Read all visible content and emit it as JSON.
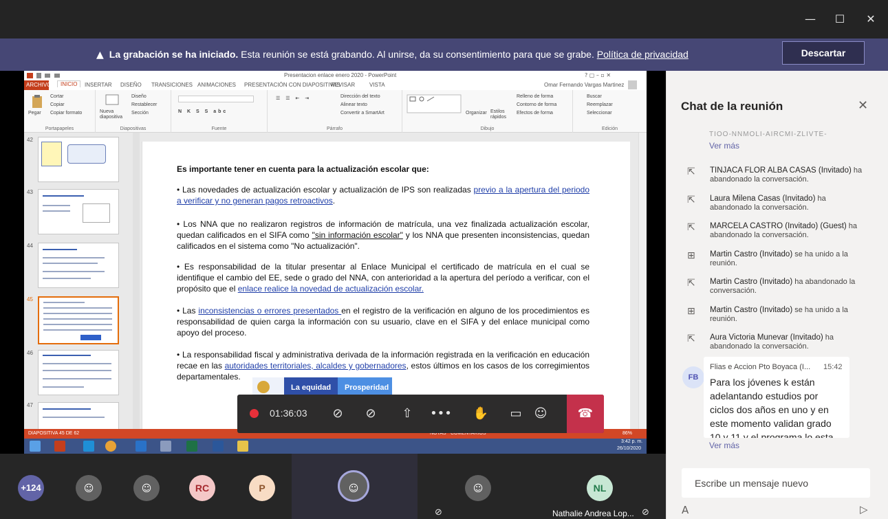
{
  "window": {
    "minimize_icon": "—",
    "maximize_icon": "☐",
    "close_icon": "✕"
  },
  "banner": {
    "bold": "La grabación se ha iniciado.",
    "text": " Esta reunión se está grabando. Al unirse, da su consentimiento para que se grabe. ",
    "link": "Política de privacidad",
    "dismiss": "Descartar"
  },
  "ppt": {
    "window_title": "Presentacion enlace enero 2020 - PowerPoint",
    "user": "Omar Fernando Vargas Martinez",
    "tabs": [
      "ARCHIVO",
      "INICIO",
      "INSERTAR",
      "DISEÑO",
      "TRANSICIONES",
      "ANIMACIONES",
      "PRESENTACIÓN CON DIAPOSITIVAS",
      "REVISAR",
      "VISTA"
    ],
    "ribbon": {
      "paste": "Pegar",
      "cut": "Cortar",
      "copy": "Copiar",
      "copy_format": "Copiar formato",
      "new_slide": "Nueva diapositiva",
      "layout": "Diseño",
      "reset": "Restablecer",
      "section": "Sección",
      "text_direction": "Dirección del texto",
      "align_text": "Alinear texto",
      "convert_smartart": "Convertir a SmartArt",
      "arrange": "Organizar",
      "styles": "Estilos rápidos",
      "shape_fill": "Relleno de forma",
      "shape_outline": "Contorno de forma",
      "shape_effects": "Efectos de forma",
      "find": "Buscar",
      "replace": "Reemplazar",
      "select": "Seleccionar",
      "groups": [
        "Portapapeles",
        "Diapositivas",
        "Fuente",
        "Párrafo",
        "Dibujo",
        "Edición"
      ]
    },
    "thumb_numbers": [
      "42",
      "43",
      "44",
      "45",
      "46",
      "47"
    ],
    "status_slide": "DIAPOSITIVA 45 DE 62",
    "status_notes": "NOTAS",
    "status_comments": "COMENTARIOS",
    "status_zoom": "86%",
    "taskbar_time": "3:42 p. m.",
    "taskbar_date": "26/10/2020"
  },
  "slide": {
    "heading": "Es importante tener en cuenta para la actualización escolar que:",
    "p1_a": "• Las novedades de actualización escolar y actualización de IPS son  realizadas ",
    "p1_link": "previo a la apertura del periodo a verificar y no generan pagos retroactivos",
    "p1_b": ".",
    "p2_a": "• Los NNA que no realizaron registros de información de matrícula, una vez finalizada actualización escolar, quedan calificados en el SIFA como ",
    "p2_link": "\"sin información escolar\"",
    "p2_b": " y los NNA que presenten inconsistencias, quedan calificados en el sistema como \"No actualización\".",
    "p3_a": "• Es responsabilidad de la titular presentar al Enlace Municipal el certificado de matrícula en el cual se identifique el cambio del EE, sede o grado del NNA, con anterioridad a la apertura del período a verificar, con el propósito que el ",
    "p3_link": "enlace realice la novedad de actualización escolar.",
    "p4_a": "• Las ",
    "p4_link": "inconsistencias o errores presentados ",
    "p4_b": "en el registro de la verificación en alguno de los procedimientos es responsabilidad de quien carga la información con su usuario, clave en el SIFA y del enlace municipal como apoyo del proceso.",
    "p5_a": "• La responsabilidad fiscal y administrativa derivada de la información registrada en la verificación en educación recae en las ",
    "p5_link": "autoridades territoriales, alcaldes y gobernadores",
    "p5_b": ", estos últimos en los casos de los corregimientos departamentales.",
    "logo_left": "La equidad",
    "logo_right": "Prosperidad"
  },
  "callbar": {
    "timer": "01:36:03"
  },
  "participants": {
    "overflow": "+124",
    "rc": "RC",
    "p": "P",
    "nl": "NL",
    "nl_name": "Nathalie Andrea Lop..."
  },
  "chat": {
    "title": "Chat de la reunión",
    "clipped": "TIOO-NNMOLI-AIRCMI-ZLIVTE-",
    "see_more": "Ver más",
    "events": [
      {
        "name": "TINJACA FLOR ALBA CASAS (Invitado)",
        "tail": " ha",
        "rest": "abandonado la conversación.",
        "icon": "⇱"
      },
      {
        "name": "Laura Milena Casas (Invitado)",
        "tail": " ha",
        "rest": "abandonado la conversación.",
        "icon": "⇱"
      },
      {
        "name": "MARCELA CASTRO (Invitado) (Guest)",
        "tail": " ha",
        "rest": "abandonado la conversación.",
        "icon": "⇱"
      },
      {
        "name": "Martin Castro (Invitado)",
        "tail": " se ha unido a la",
        "rest": "reunión.",
        "icon": "⊞"
      },
      {
        "name": "Martin Castro (Invitado)",
        "tail": " ha abandonado la",
        "rest": "conversación.",
        "icon": "⇱"
      },
      {
        "name": "Martin Castro (Invitado)",
        "tail": " se ha unido a la",
        "rest": "reunión.",
        "icon": "⊞"
      },
      {
        "name": "Aura Victoria Munevar (Invitado)",
        "tail": " ha",
        "rest": "abandonado la conversación.",
        "icon": "⇱"
      }
    ],
    "message": {
      "initials": "FB",
      "author": "Flias e Accion Pto Boyaca (I...",
      "time": "15:42",
      "body": "Para los jóvenes k están adelantando estudios por ciclos dos años en uno y en este momento validan grado 10 y 11 y el programa lo esta"
    },
    "see_more_2": "Ver más",
    "compose_placeholder": "Escribe un mensaje nuevo"
  }
}
